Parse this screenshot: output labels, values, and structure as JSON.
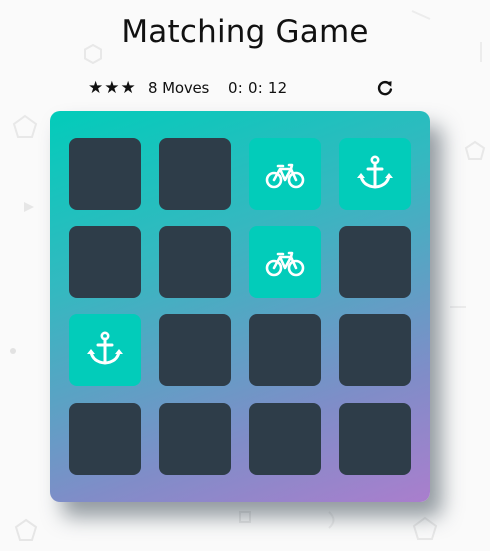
{
  "title": "Matching Game",
  "score_panel": {
    "stars": [
      "★",
      "★",
      "★"
    ],
    "moves_count": "8",
    "moves_label": "Moves",
    "timer": "0: 0: 12"
  },
  "deck": {
    "cards": [
      {
        "state": "closed",
        "icon": ""
      },
      {
        "state": "closed",
        "icon": ""
      },
      {
        "state": "open",
        "icon": "bicycle-icon"
      },
      {
        "state": "open",
        "icon": "anchor-icon"
      },
      {
        "state": "closed",
        "icon": ""
      },
      {
        "state": "closed",
        "icon": ""
      },
      {
        "state": "open",
        "icon": "bicycle-icon"
      },
      {
        "state": "closed",
        "icon": ""
      },
      {
        "state": "open",
        "icon": "anchor-icon"
      },
      {
        "state": "closed",
        "icon": ""
      },
      {
        "state": "closed",
        "icon": ""
      },
      {
        "state": "closed",
        "icon": ""
      },
      {
        "state": "closed",
        "icon": ""
      },
      {
        "state": "closed",
        "icon": ""
      },
      {
        "state": "closed",
        "icon": ""
      },
      {
        "state": "closed",
        "icon": ""
      }
    ]
  },
  "colors": {
    "card_closed": "#2e3d49",
    "card_open": "#02ccba",
    "deck_gradient_start": "#02ccba",
    "deck_gradient_end": "#aa7ecd"
  }
}
